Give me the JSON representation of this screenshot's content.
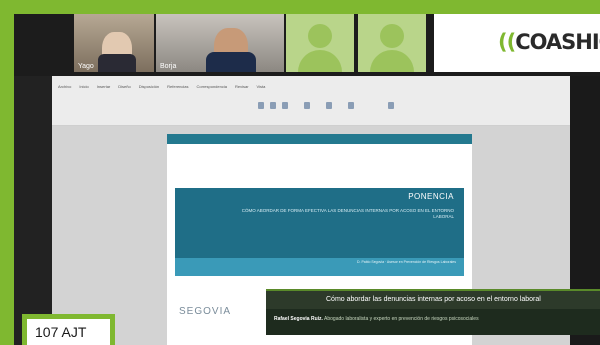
{
  "meeting": {
    "participants": [
      {
        "name": "Yago"
      },
      {
        "name": "Borja"
      }
    ],
    "logo_text": "COASHIQ",
    "logo_mark": "®"
  },
  "ribbon": {
    "tabs": [
      "Archivo",
      "Inicio",
      "Insertar",
      "Diseño",
      "Disposición",
      "Referencias",
      "Correspondencia",
      "Revisar",
      "Vista"
    ]
  },
  "document": {
    "heading": "PONENCIA",
    "subtitle": "CÓMO ABORDAR DE FORMA EFECTIVA LAS DENUNCIAS INTERNAS POR ACOSO EN EL ENTORNO LABORAL",
    "author": "D. Pablo Segovia · Asesor en Prevención de Riesgos Laborales",
    "footer_brand": "SEGOVIA"
  },
  "caption": {
    "title": "Cómo abordar las denuncias internas por acoso en el entorno laboral",
    "speaker": "Rafael Segovia Ruiz.",
    "speaker_role": "Abogado laboralista y experto en prevención de riesgos psicosociales"
  },
  "tag": {
    "label": "107 AJT"
  },
  "colors": {
    "accent": "#7fb830",
    "doc_primary": "#1f6e87",
    "doc_secondary": "#3a9ab8"
  }
}
